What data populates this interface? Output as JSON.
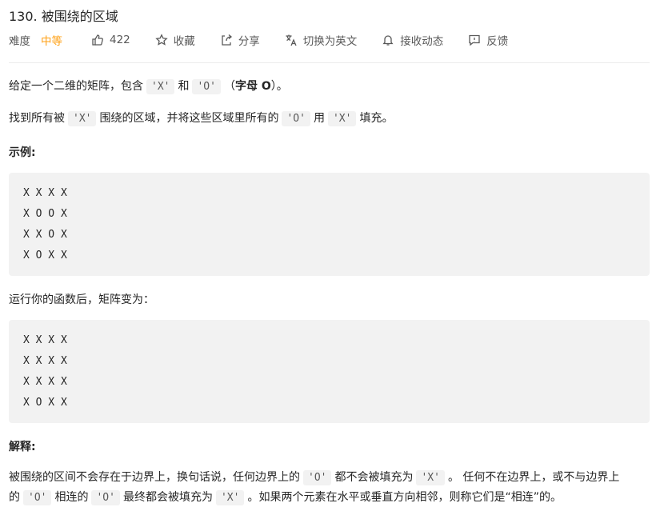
{
  "problem": {
    "title": "130. 被围绕的区域"
  },
  "toolbar": {
    "difficulty_label": "难度",
    "difficulty_value": "中等",
    "likes": "422",
    "favorite": "收藏",
    "share": "分享",
    "translate": "切换为英文",
    "subscribe": "接收动态",
    "feedback": "反馈",
    "colors": {
      "difficulty": "#ffa116"
    }
  },
  "desc": {
    "p1_a": "给定一个二维的矩阵，包含",
    "p1_x": "'X'",
    "p1_b": "和",
    "p1_o": "'O'",
    "p1_c": "（",
    "p1_bold": "字母 O",
    "p1_d": "）。",
    "p2_a": "找到所有被",
    "p2_x": "'X'",
    "p2_b": "围绕的区域，并将这些区域里所有的",
    "p2_o": "'O'",
    "p2_c": "用",
    "p2_x2": "'X'",
    "p2_d": "填充。"
  },
  "example": {
    "heading": "示例:",
    "input": "X X X X\nX O O X\nX X O X\nX O X X",
    "after": "运行你的函数后，矩阵变为：",
    "output": "X X X X\nX X X X\nX X X X\nX O X X"
  },
  "explanation": {
    "heading": "解释:",
    "t1": "被围绕的区间不会存在于边界上，换句话说，任何边界上的",
    "c1": "'O'",
    "t2": "都不会被填充为",
    "c2": "'X'",
    "t3": "。 任何不在边界上，或不与边界上的",
    "c3": "'O'",
    "t4": "相连的",
    "c4": "'O'",
    "t5": "最终都会被填充为",
    "c5": "'X'",
    "t6": "。如果两个元素在水平或垂直方向相邻，则称它们是“相连”的。"
  }
}
